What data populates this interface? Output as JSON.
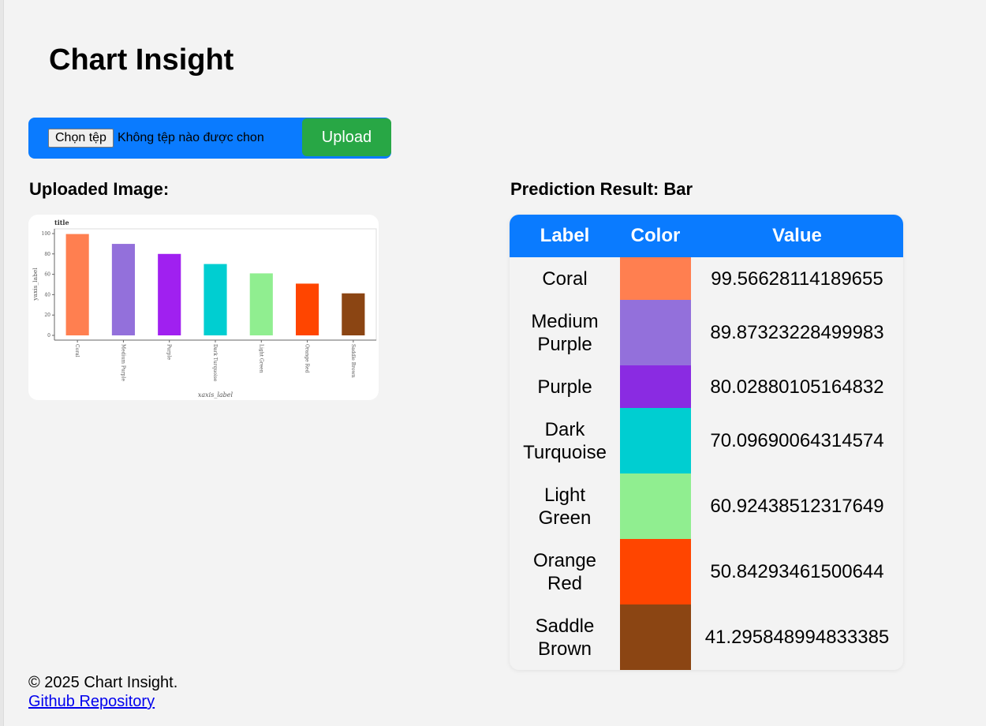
{
  "app": {
    "title": "Chart Insight"
  },
  "upload": {
    "choose_file_label": "Chọn tệp",
    "no_file_text": "Không tệp nào được chon",
    "upload_label": "Upload"
  },
  "uploaded_heading": "Uploaded Image:",
  "prediction_heading": "Prediction Result: Bar",
  "chart_data": {
    "type": "bar",
    "title": "title",
    "xlabel": "xaxis_label",
    "ylabel": "yaxis_label",
    "ylim": [
      0,
      100
    ],
    "yticks": [
      "0",
      "20",
      "40",
      "60",
      "80",
      "100"
    ],
    "categories": [
      "Coral",
      "Medium Purple",
      "Purple",
      "Dark Turquoise",
      "Light Green",
      "Orange Red",
      "Saddle Brown"
    ],
    "values": [
      99.56628114189655,
      89.87323228499983,
      80.02880105164832,
      70.09690064314574,
      60.92438512317649,
      50.84293461500644,
      41.295848994833385
    ],
    "colors": [
      "#ff7f50",
      "#9370db",
      "#a020f0",
      "#00ced1",
      "#90ee90",
      "#ff4500",
      "#8b4513"
    ]
  },
  "table": {
    "headers": [
      "Label",
      "Color",
      "Value"
    ],
    "rows": [
      {
        "label": "Coral",
        "color": "#ff7f50",
        "value": "99.56628114189655"
      },
      {
        "label": "Medium Purple",
        "color": "#9370db",
        "value": "89.87323228499983"
      },
      {
        "label": "Purple",
        "color": "#8a2be2",
        "value": "80.02880105164832"
      },
      {
        "label": "Dark Turquoise",
        "color": "#00ced1",
        "value": "70.09690064314574"
      },
      {
        "label": "Light Green",
        "color": "#90ee90",
        "value": "60.92438512317649"
      },
      {
        "label": "Orange Red",
        "color": "#ff4500",
        "value": "50.84293461500644"
      },
      {
        "label": "Saddle Brown",
        "color": "#8b4513",
        "value": "41.295848994833385"
      }
    ]
  },
  "footer": {
    "copyright": "© 2025 Chart Insight.",
    "link_text": "Github Repository"
  }
}
